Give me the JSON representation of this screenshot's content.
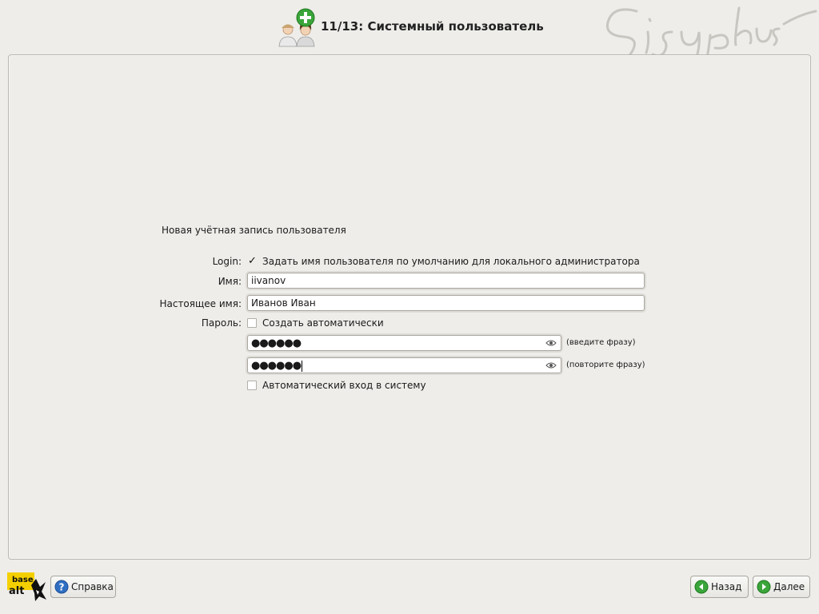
{
  "header": {
    "title": "11/13: Системный пользователь",
    "icon": "users-add-icon",
    "brand_signature": "Sisyphus"
  },
  "form": {
    "heading": "Новая учётная запись пользователя",
    "login": {
      "label": "Login:",
      "checkbox_checked": true,
      "checkbox_label": "Задать имя пользователя по умолчанию для локального администратора"
    },
    "name": {
      "label": "Имя:",
      "value": "iivanov"
    },
    "realname": {
      "label": "Настоящее имя:",
      "value": "Иванов Иван"
    },
    "password": {
      "label": "Пароль:",
      "auto_checked": false,
      "auto_label": "Создать автоматически",
      "field1_mask": "●●●●●●",
      "field1_hint": "(введите фразу)",
      "field2_mask": "●●●●●●",
      "field2_hint": "(повторите фразу)"
    },
    "autologin": {
      "checked": false,
      "label": "Автоматический вход в систему"
    }
  },
  "footer": {
    "logo_text_top": "base",
    "logo_text_bottom": "alt",
    "help_label": "Справка",
    "back_label": "Назад",
    "next_label": "Далее"
  },
  "colors": {
    "background": "#eeedea",
    "accent_green": "#3aa53a",
    "help_blue": "#2f6fc2",
    "logo_yellow": "#f5d000"
  }
}
